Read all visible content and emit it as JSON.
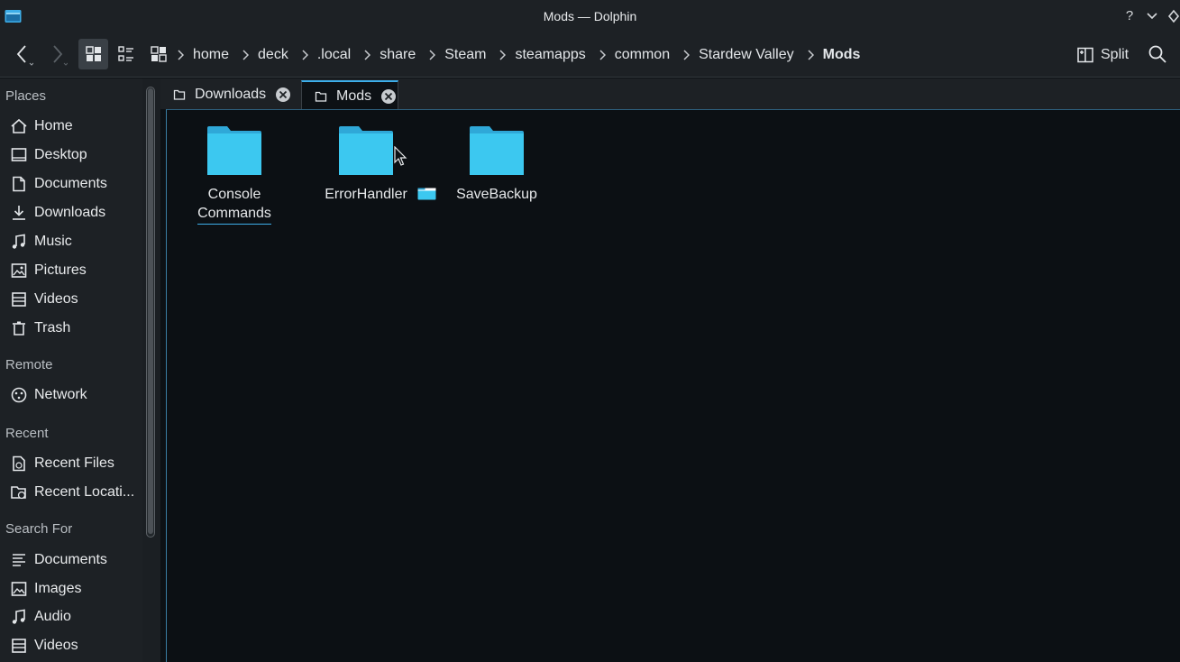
{
  "window": {
    "title": "Mods — Dolphin"
  },
  "titlebar_buttons": [
    "help-icon",
    "minimize-icon",
    "pin-icon"
  ],
  "toolbar": {
    "breadcrumb": [
      "home",
      "deck",
      ".local",
      "share",
      "Steam",
      "steamapps",
      "common",
      "Stardew Valley",
      "Mods"
    ],
    "split_label": "Split"
  },
  "sidebar": {
    "sections": [
      {
        "title": "Places",
        "items": [
          {
            "label": "Home",
            "icon": "home-icon"
          },
          {
            "label": "Desktop",
            "icon": "desktop-icon"
          },
          {
            "label": "Documents",
            "icon": "documents-icon"
          },
          {
            "label": "Downloads",
            "icon": "downloads-icon"
          },
          {
            "label": "Music",
            "icon": "music-icon"
          },
          {
            "label": "Pictures",
            "icon": "pictures-icon"
          },
          {
            "label": "Videos",
            "icon": "videos-icon"
          },
          {
            "label": "Trash",
            "icon": "trash-icon"
          }
        ]
      },
      {
        "title": "Remote",
        "items": [
          {
            "label": "Network",
            "icon": "network-icon"
          }
        ]
      },
      {
        "title": "Recent",
        "items": [
          {
            "label": "Recent Files",
            "icon": "recent-files-icon"
          },
          {
            "label": "Recent Locati...",
            "icon": "recent-locations-icon"
          }
        ]
      },
      {
        "title": "Search For",
        "items": [
          {
            "label": "Documents",
            "icon": "documents-search-icon"
          },
          {
            "label": "Images",
            "icon": "images-icon"
          },
          {
            "label": "Audio",
            "icon": "audio-icon"
          },
          {
            "label": "Videos",
            "icon": "videos-icon"
          }
        ]
      }
    ]
  },
  "tabs": [
    {
      "label": "Downloads",
      "active": false
    },
    {
      "label": "Mods",
      "active": true
    }
  ],
  "files": [
    {
      "name_line1": "Console",
      "name_line2": "Commands",
      "type": "folder"
    },
    {
      "name_line1": "ErrorHandler",
      "name_line2": "",
      "type": "folder"
    },
    {
      "name_line1": "SaveBackup",
      "name_line2": "",
      "type": "folder"
    }
  ],
  "colors": {
    "accent": "#3daee9",
    "folder": "#3cc8f0",
    "background": "#0c1014",
    "chrome": "#1d2125"
  }
}
